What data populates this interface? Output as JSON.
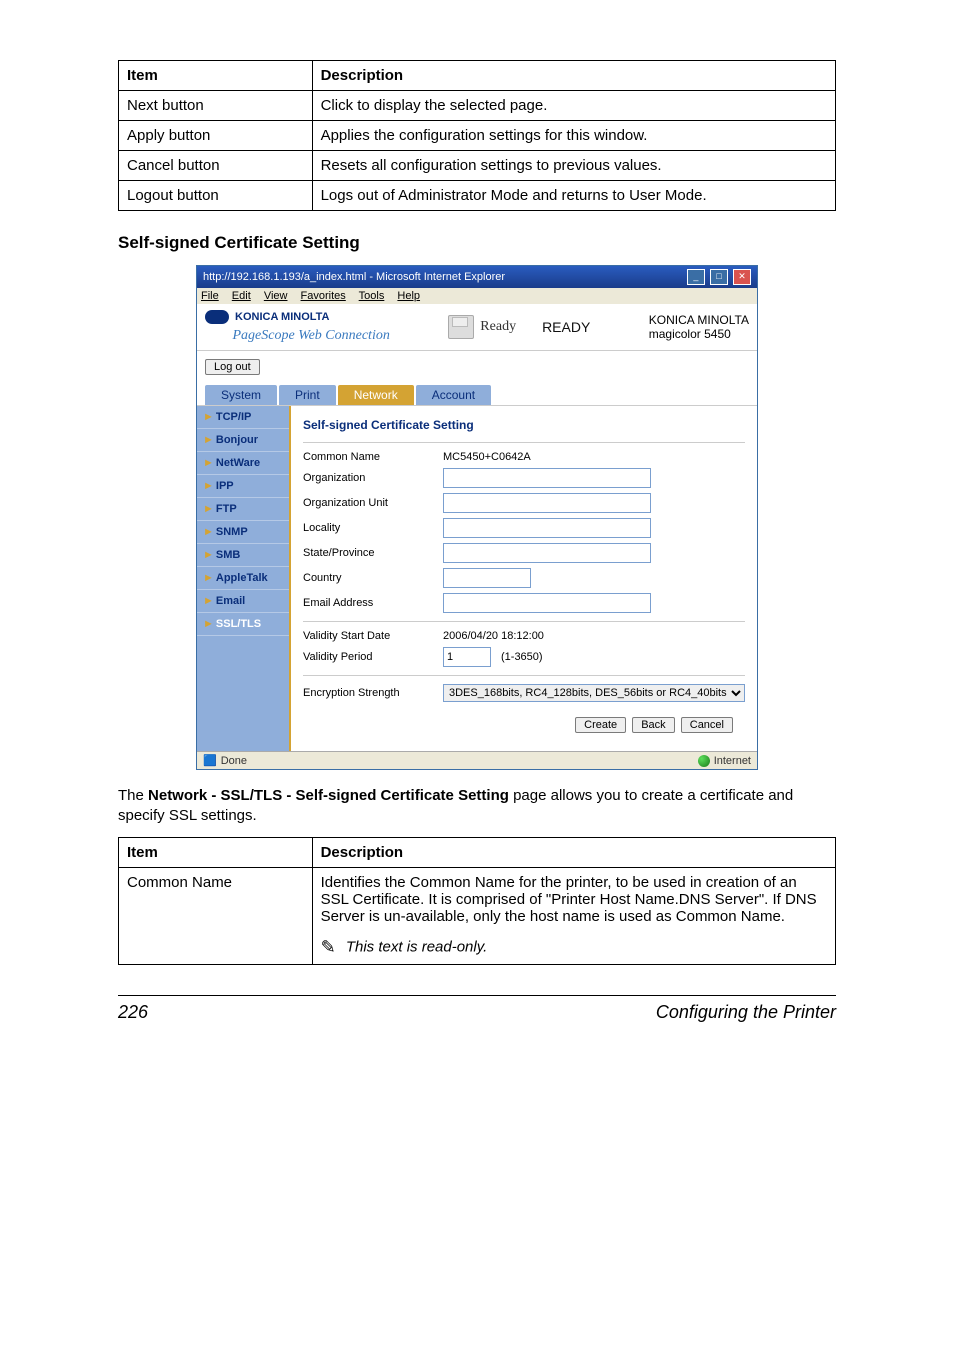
{
  "table1": {
    "headers": [
      "Item",
      "Description"
    ],
    "rows": [
      [
        "Next button",
        "Click to display the selected page."
      ],
      [
        "Apply button",
        "Applies the configuration settings for this window."
      ],
      [
        "Cancel button",
        "Resets all configuration settings to previous values."
      ],
      [
        "Logout button",
        "Logs out of Administrator Mode and returns to User Mode."
      ]
    ]
  },
  "section_heading": "Self-signed Certificate Setting",
  "screenshot": {
    "window_title": "http://192.168.1.193/a_index.html - Microsoft Internet Explorer",
    "menubar": [
      "File",
      "Edit",
      "View",
      "Favorites",
      "Tools",
      "Help"
    ],
    "brand": "KONICA MINOLTA",
    "webconn": "PageScope Web Connection",
    "ready_small": "Ready",
    "ready_big": "READY",
    "device_maker": "KONICA MINOLTA",
    "device_model": "magicolor 5450",
    "logout": "Log out",
    "tabs": [
      "System",
      "Print",
      "Network",
      "Account"
    ],
    "side_items": [
      "TCP/IP",
      "Bonjour",
      "NetWare",
      "IPP",
      "FTP",
      "SNMP",
      "SMB",
      "AppleTalk",
      "Email",
      "SSL/TLS"
    ],
    "panel_title": "Self-signed Certificate Setting",
    "fields": {
      "common_name_lbl": "Common Name",
      "common_name_val": "MC5450+C0642A",
      "organization_lbl": "Organization",
      "orgunit_lbl": "Organization Unit",
      "locality_lbl": "Locality",
      "state_lbl": "State/Province",
      "country_lbl": "Country",
      "email_lbl": "Email Address",
      "vstart_lbl": "Validity Start Date",
      "vstart_val": "2006/04/20 18:12:00",
      "vperiod_lbl": "Validity Period",
      "vperiod_val": "1",
      "vperiod_range": "(1-3650)",
      "enc_lbl": "Encryption Strength",
      "enc_val": "3DES_168bits, RC4_128bits, DES_56bits or RC4_40bits"
    },
    "buttons": [
      "Create",
      "Back",
      "Cancel"
    ],
    "status_left": "Done",
    "status_right": "Internet"
  },
  "para": {
    "pre": "The ",
    "bold": "Network - SSL/TLS - Self-signed Certificate Setting",
    "post": " page allows you to create a certificate and specify SSL settings."
  },
  "table2": {
    "headers": [
      "Item",
      "Description"
    ],
    "row_item": "Common Name",
    "row_desc": "Identifies the Common Name for the printer, to be used in creation of an SSL Certificate. It is com­prised of \"Printer Host Name.DNS Server\". If DNS Server is un-available, only the host name is used as Common Name.",
    "note": "This text is read-only."
  },
  "footer": {
    "page": "226",
    "title": "Configuring the Printer"
  }
}
